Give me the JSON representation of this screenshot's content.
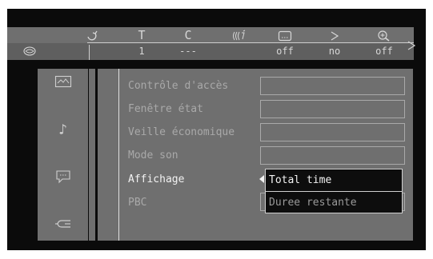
{
  "header": {
    "icons": [
      {
        "name": "title-icon",
        "glyph": "⚉"
      },
      {
        "name": "T",
        "glyph": "T"
      },
      {
        "name": "C",
        "glyph": "C"
      },
      {
        "name": "audio-icon",
        "glyph": "(((’"
      },
      {
        "name": "subtitle-icon",
        "glyph": "▭"
      },
      {
        "name": "angle-icon",
        "glyph": "⋄"
      },
      {
        "name": "zoom-icon",
        "glyph": "⊕"
      }
    ],
    "values": [
      "1",
      "---",
      "off",
      "no",
      "off"
    ]
  },
  "sidebar": {
    "items": [
      {
        "name": "picture"
      },
      {
        "name": "sound"
      },
      {
        "name": "language"
      },
      {
        "name": "features"
      }
    ]
  },
  "menu": {
    "items": [
      {
        "label": "Contrôle d'accès"
      },
      {
        "label": "Fenêtre état"
      },
      {
        "label": "Veille économique"
      },
      {
        "label": "Mode son"
      },
      {
        "label": "Affichage"
      },
      {
        "label": "PBC"
      }
    ]
  },
  "dropdown": {
    "options": [
      "Total time",
      "Duree restante"
    ]
  },
  "colors": {
    "panel": "#6f6f6f",
    "background": "#0b0b0b",
    "text_dim": "#a9a9a9",
    "text_active": "#f2f2f2"
  }
}
